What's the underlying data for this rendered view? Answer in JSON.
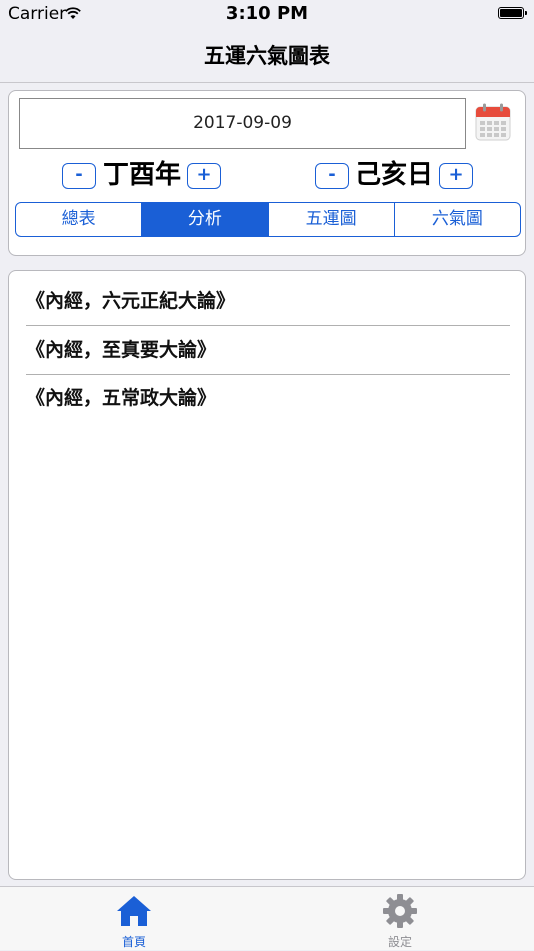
{
  "status": {
    "carrier": "Carrier",
    "time": "3:10 PM"
  },
  "nav": {
    "title": "五運六氣圖表"
  },
  "date_field": {
    "value": "2017-09-09"
  },
  "year": {
    "minus": "-",
    "label": "丁酉年",
    "plus": "+"
  },
  "day": {
    "minus": "-",
    "label": "己亥日",
    "plus": "+"
  },
  "segments": [
    {
      "label": "總表"
    },
    {
      "label": "分析",
      "selected": true
    },
    {
      "label": "五運圖"
    },
    {
      "label": "六氣圖"
    }
  ],
  "list": [
    {
      "label": "《內經，六元正紀大論》"
    },
    {
      "label": "《內經，至真要大論》"
    },
    {
      "label": "《內經，五常政大論》"
    }
  ],
  "tabs": [
    {
      "label": "首頁",
      "icon": "home-icon",
      "active": true
    },
    {
      "label": "設定",
      "icon": "gear-icon",
      "active": false
    }
  ],
  "colors": {
    "accent": "#1a5fd6",
    "background": "#efeff4",
    "calendar_red": "#e74c3c"
  }
}
